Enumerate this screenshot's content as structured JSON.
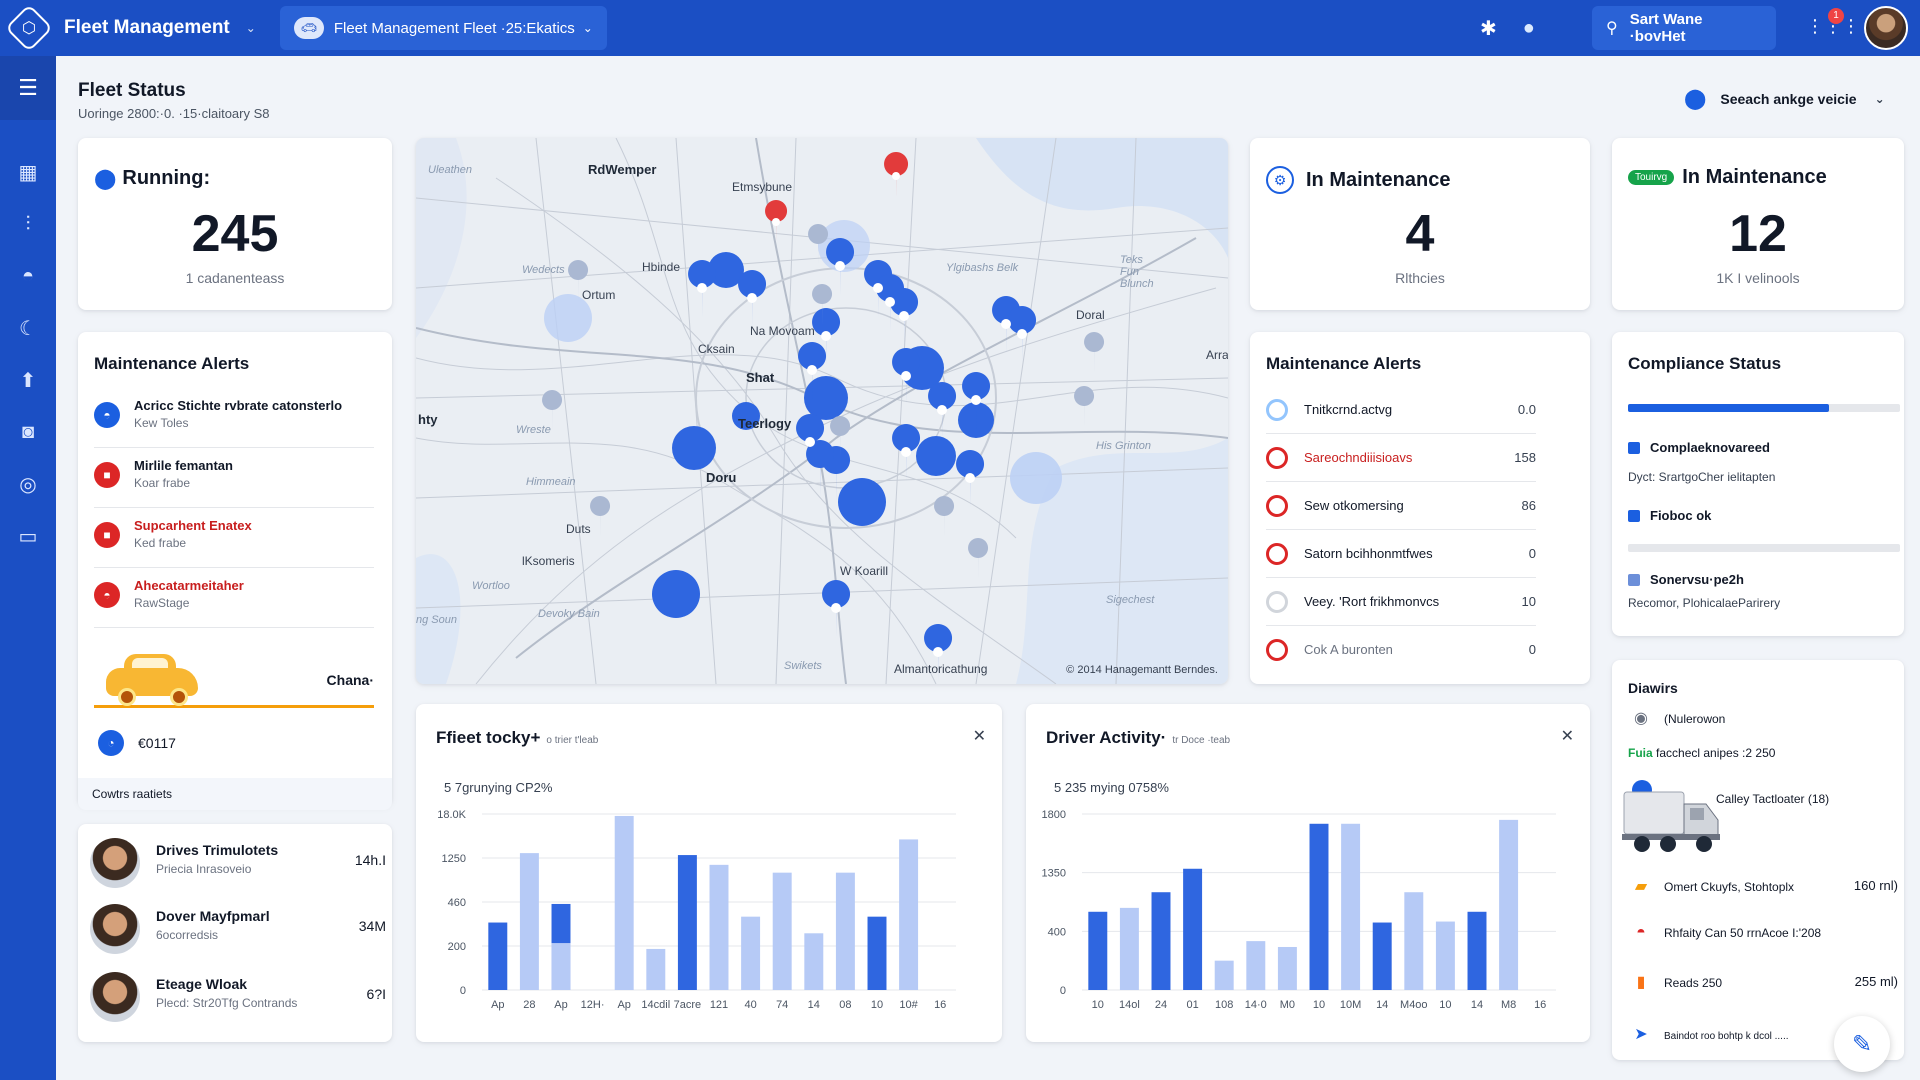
{
  "header": {
    "app_title": "Fleet Management",
    "fleet_selector": "Fleet Management Fleet ·25:Ekatics",
    "search_label": "Sart Wane ·bovHet",
    "notification_count": "1"
  },
  "page": {
    "title": "Fleet Status",
    "subtitle": "Uoringe 2800:·0. ·15·claitoary S8",
    "vehicle_select": "Seeach ankge veicie"
  },
  "stats": [
    {
      "label": "Running:",
      "value": "245",
      "sub": "1 cadanenteass"
    },
    {
      "label": "In Maintenance",
      "value": "4",
      "sub": "Rlthcies"
    },
    {
      "label": "In Maintenance",
      "badge": "Touirvg",
      "value": "12",
      "sub": "1K I velinools"
    }
  ],
  "left_alerts": {
    "title": "Maintenance Alerts",
    "items": [
      {
        "title": "Acricc Stichte rvbrate catonsterlo",
        "sub": "Kew Toles",
        "color": "#1b5fe0",
        "icon": "car-icon"
      },
      {
        "title": "Mirlile femantan",
        "sub": "Koar frabe",
        "color": "#dc2626",
        "icon": "alert-icon"
      },
      {
        "title": "Supcarhent Enatex",
        "sub": "Ked frabe",
        "color": "#dc2626",
        "icon": "alert-icon"
      },
      {
        "title": "Ahecatarmeitaher",
        "sub": "RawStage",
        "color": "#dc2626",
        "icon": "car-icon"
      }
    ],
    "chana": "Chana·",
    "count": "€0117",
    "footer": "Cowtrs raatiets"
  },
  "drivers": [
    {
      "name": "Drives Trimulotets",
      "role": "Priecia Inrasoveio",
      "value": "14h.I"
    },
    {
      "name": "Dover Mayfpmarl",
      "role": "6ocorredsis",
      "value": "34M"
    },
    {
      "name": "Eteage Wloak",
      "role": "Plecd: Str20Tfg Contrands",
      "value": "6?I"
    }
  ],
  "map": {
    "labels": [
      "RdWemper",
      "Etmsybune",
      "Uleathen",
      "Hbinde",
      "Ylgibashs Belk",
      "Teks Fun Blunch",
      "Wedects",
      "Ortum",
      "Doral",
      "Cksain",
      "Na Movoam",
      "Shat",
      "Teerlogy",
      "Arra",
      "hty",
      "Wreste",
      "Doru",
      "Himmeain",
      "His Grinton",
      "Duts",
      "lKsomeris",
      "Wortloo",
      "W Koarill",
      "Sigechest",
      "ng Soun",
      "Devoky Bain",
      "Swikets",
      "Almantoricathung"
    ],
    "copyright": "© 2014 Hanagemantt Berndes."
  },
  "right_alerts": {
    "title": "Maintenance Alerts",
    "items": [
      {
        "label": "Tnitkcrnd.actvg",
        "value": "0.0",
        "state": "blue"
      },
      {
        "label": "Sareochndiiisioavs",
        "value": "158",
        "state": "red"
      },
      {
        "label": "Sew otkomersing",
        "value": "86",
        "state": "red-dark"
      },
      {
        "label": "Satorn bcihhonmtfwes",
        "value": "0",
        "state": "red-dark"
      },
      {
        "label": "Veey. 'Rort frikhmonvcs",
        "value": "10",
        "state": "grey"
      },
      {
        "label": "Cok A buronten",
        "value": "0",
        "state": "red-dark"
      }
    ]
  },
  "compliance": {
    "title": "Compliance Status",
    "progress_1": 0.74,
    "item_1": "Complaeknovareed",
    "sub_1": "Dyct: SrartgoCher ielitapten",
    "item_2": "Fioboc ok",
    "progress_2": 0,
    "item_3": "Sonervsu·pe2h",
    "sub_3": "Recomor, PlohicalaeParirery"
  },
  "diawirs": {
    "title": "Diawirs",
    "item_1": "(Nulerowon",
    "item_2_prefix": "Fuia",
    "item_2": " facchecl anipes :2 250",
    "truck_label": "Calley Tactloater (18)",
    "item_3": "Omert Ckuyfs, Stohtoplx",
    "item_3_value": "160 rnl)",
    "item_4": "Rhfaity Can 50 rrnAcoe I:'208",
    "item_5": "Reads 250",
    "item_5_value": "255 ml)",
    "item_6": "Baindot roo bohtp k dcol ....."
  },
  "charts": {
    "fleet_title": "Ffieet tocky+",
    "fleet_title_small": "o trier t'leab",
    "fleet_sub": "5 7grunying CP2%",
    "driver_title": "Driver Activity·",
    "driver_title_small": "tr Doce ·teab",
    "driver_sub": "5 235 mying 0758%"
  },
  "chart_data": [
    {
      "type": "bar",
      "title": "Ffieet tocky+",
      "y_tick_labels": [
        "0",
        "200",
        "460",
        "1250",
        "18.0K"
      ],
      "x_tick_labels": [
        "Ap",
        "28",
        "Ap",
        "12H·",
        "Ap",
        "14cdil",
        "7acre",
        "121",
        "40",
        "74",
        "14",
        "08",
        "10",
        "10#",
        "16"
      ],
      "series": [
        {
          "color": "#2f66e0",
          "values": [
            690,
            null,
            880,
            null,
            null,
            null,
            1380,
            null,
            null,
            null,
            null,
            null,
            750,
            null,
            null
          ]
        },
        {
          "color": "#b6caf6",
          "values": [
            null,
            1400,
            480,
            null,
            1780,
            420,
            null,
            1280,
            750,
            1200,
            580,
            1200,
            null,
            1540,
            null
          ]
        }
      ],
      "ylim": [
        0,
        1800
      ]
    },
    {
      "type": "bar",
      "title": "Driver Activity·",
      "y_tick_labels": [
        "0",
        "400",
        "1350",
        "1800"
      ],
      "x_tick_labels": [
        "10",
        "14ol",
        "24",
        "01",
        "108",
        "14·0",
        "M0",
        "10",
        "10M",
        "14",
        "M4oo",
        "10",
        "14",
        "M8",
        "16"
      ],
      "series": [
        {
          "color": "#2f66e0",
          "values": [
            800,
            null,
            1000,
            1240,
            null,
            null,
            null,
            1700,
            null,
            690,
            null,
            null,
            800,
            null,
            null
          ]
        },
        {
          "color": "#b6caf6",
          "values": [
            null,
            840,
            null,
            null,
            300,
            500,
            440,
            null,
            1700,
            null,
            1000,
            700,
            null,
            1740,
            null
          ]
        }
      ],
      "ylim": [
        0,
        1800
      ]
    }
  ]
}
